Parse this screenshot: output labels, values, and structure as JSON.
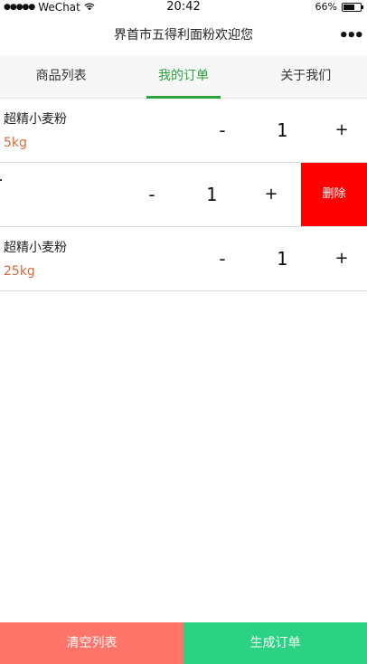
{
  "status_bar": {
    "carrier": "WeChat",
    "time": "20:42",
    "battery": "66%",
    "battery_level": 0.66
  },
  "nav": {
    "title": "界首市五得利面粉欢迎您",
    "more": "•••"
  },
  "tabs": [
    {
      "label": "商品列表",
      "active": false
    },
    {
      "label": "我的订单",
      "active": true
    },
    {
      "label": "关于我们",
      "active": false
    }
  ],
  "orders": [
    {
      "name": "超精小麦粉",
      "spec": "5kg",
      "qty": "1",
      "minus": "-",
      "plus": "+"
    },
    {
      "name": "",
      "spec": "",
      "qty": "1",
      "minus": "-",
      "plus": "+",
      "delete_label": "删除"
    },
    {
      "name": "超精小麦粉",
      "spec": "25kg",
      "qty": "1",
      "minus": "-",
      "plus": "+"
    }
  ],
  "footer": {
    "clear_label": "清空列表",
    "create_label": "生成订单"
  },
  "colors": {
    "accent": "#2aa33a",
    "spec": "#d66a3a",
    "delete": "#ff0000",
    "clear": "#ff7468",
    "create": "#2bd283"
  }
}
